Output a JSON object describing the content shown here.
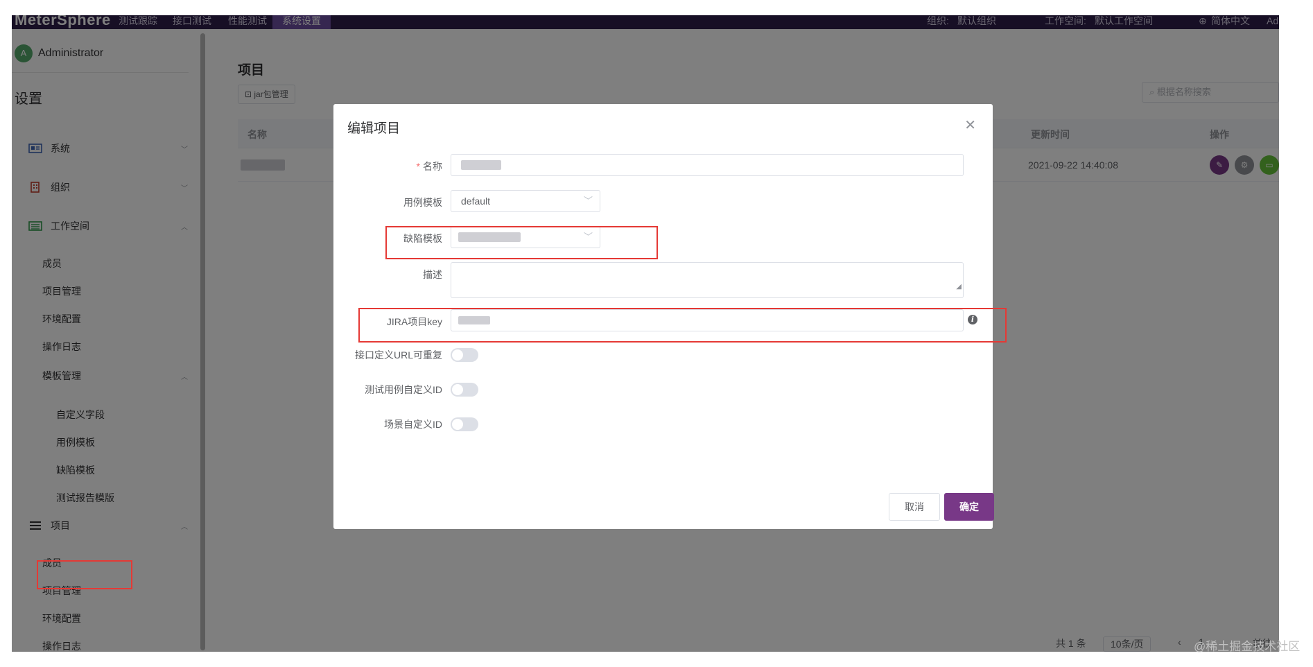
{
  "topnav": {
    "logo": "MeterSphere",
    "items": [
      "测试跟踪",
      "接口测试",
      "性能测试",
      "系统设置"
    ],
    "org_label": "组织:",
    "org_value": "默认组织",
    "ws_label": "工作空间:",
    "ws_value": "默认工作空间",
    "lang": "简体中文",
    "user_short": "Ad"
  },
  "sidebar": {
    "avatar_letter": "A",
    "user_name": "Administrator",
    "title": "设置",
    "groups": {
      "system": "系统",
      "org": "组织",
      "workspace": "工作空间",
      "project": "项目"
    },
    "workspace_items": [
      "成员",
      "项目管理",
      "环境配置",
      "操作日志"
    ],
    "template_group": "模板管理",
    "template_items": [
      "自定义字段",
      "用例模板",
      "缺陷模板",
      "测试报告模版"
    ],
    "project_items": [
      "成员",
      "项目管理",
      "环境配置",
      "操作日志"
    ]
  },
  "main": {
    "title": "项目",
    "jar_button": "jar包管理",
    "search_placeholder": "根据名称搜索",
    "columns": {
      "name": "名称",
      "update_time": "更新时间",
      "actions": "操作"
    },
    "rows": [
      {
        "update_time": "2021-09-22 14:40:08"
      }
    ],
    "pager": {
      "total": "共 1 条",
      "page_size": "10条/页",
      "page": "1",
      "goto": "前往"
    }
  },
  "dialog": {
    "title": "编辑项目",
    "fields": {
      "name_label": "名称",
      "case_template_label": "用例模板",
      "case_template_value": "default",
      "issue_template_label": "缺陷模板",
      "description_label": "描述",
      "jira_key_label": "JIRA项目key",
      "api_url_repeat_label": "接口定义URL可重复",
      "case_custom_id_label": "测试用例自定义ID",
      "scenario_custom_id_label": "场景自定义ID"
    },
    "toggles": {
      "api_url_repeat": false,
      "case_custom_id": false,
      "scenario_custom_id": false
    },
    "cancel": "取消",
    "confirm": "确定"
  },
  "icons": [
    "settings-icon",
    "org-icon",
    "workspace-icon",
    "project-icon",
    "info-icon",
    "close-icon",
    "chevron-icon",
    "globe-icon",
    "search-icon",
    "edit-icon",
    "gear-icon",
    "delete-icon"
  ],
  "colors": {
    "nav": "#2e1f4a",
    "accent": "#783887",
    "highlight": "#e53935"
  },
  "watermark": "@稀土掘金技术社区"
}
